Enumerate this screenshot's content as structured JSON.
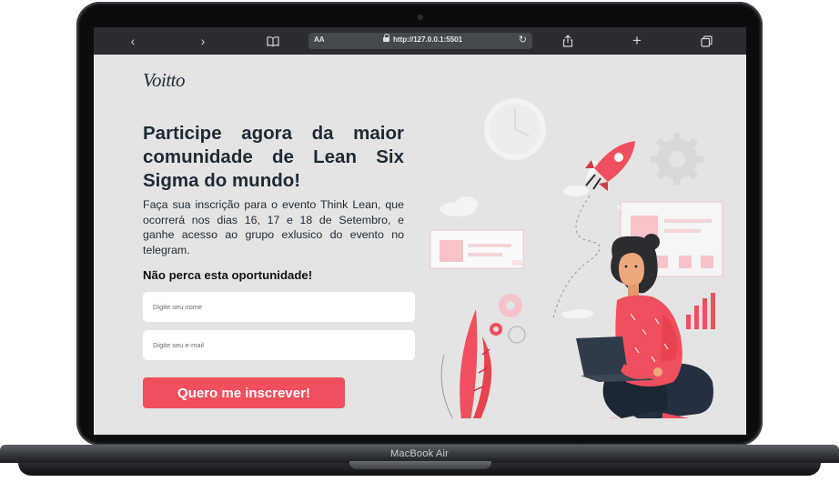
{
  "browser": {
    "text_size_label": "AA",
    "url": "http://127.0.0.1:5501"
  },
  "page": {
    "logo": "Voitto",
    "headline": "Participe agora da maior comunidade de Lean Six Sigma do mundo!",
    "description": "Faça sua inscrição para o evento Think Lean, que ocorrerá nos dias 16, 17 e 18 de Setembro, e ganhe acesso ao grupo exlusico do evento no telegram.",
    "subheadline": "Não perca esta oportunidade!",
    "name_placeholder": "Digite seu nome",
    "email_placeholder": "Digite seu e-mail",
    "cta_label": "Quero me inscrever!"
  },
  "device": {
    "model": "MacBook Air"
  },
  "colors": {
    "accent": "#f04f5d",
    "text_dark": "#1f2a36",
    "page_bg": "#e4e4e4"
  },
  "icons": [
    "back-icon",
    "forward-icon",
    "bookmarks-icon",
    "lock-icon",
    "reload-icon",
    "share-icon",
    "new-tab-icon",
    "tabs-icon"
  ]
}
